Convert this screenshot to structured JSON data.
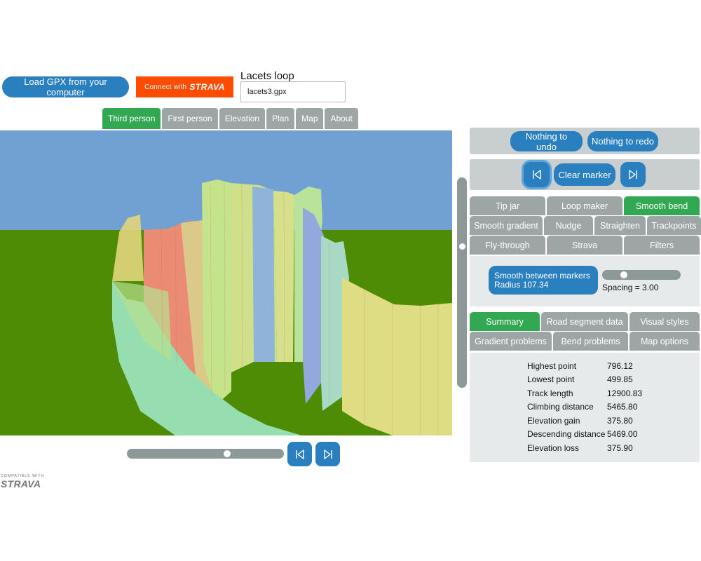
{
  "header": {
    "load_label": "Load GPX from your computer",
    "strava_connect_prefix": "Connect with",
    "strava_connect_brand": "STRAVA",
    "route_title": "Lacets loop",
    "file_name": "lacets3.gpx"
  },
  "view_tabs": [
    {
      "label": "Third person",
      "active": true
    },
    {
      "label": "First person",
      "active": false
    },
    {
      "label": "Elevation",
      "active": false
    },
    {
      "label": "Plan",
      "active": false
    },
    {
      "label": "Map",
      "active": false
    },
    {
      "label": "About",
      "active": false
    }
  ],
  "scene": {
    "sky_color": "#71a0d2",
    "ground_color": "#4e8c06",
    "description_icon": "3d-route-render"
  },
  "playback": {
    "position": 0.65,
    "prev_icon": "skip-previous-icon",
    "next_icon": "skip-next-icon"
  },
  "badge": {
    "small": "COMPATIBLE WITH",
    "big": "STRAVA"
  },
  "panel": {
    "undo_label": "Nothing to undo",
    "redo_label": "Nothing to redo",
    "clear_marker_label": "Clear marker",
    "tools_row1": [
      {
        "label": "Tip jar",
        "active": false
      },
      {
        "label": "Loop maker",
        "active": false
      },
      {
        "label": "Smooth bend",
        "active": true
      }
    ],
    "tools_row2": [
      {
        "label": "Smooth gradient",
        "active": false
      },
      {
        "label": "Nudge",
        "active": false
      },
      {
        "label": "Straighten",
        "active": false
      },
      {
        "label": "Trackpoints",
        "active": false
      }
    ],
    "tools_row3": [
      {
        "label": "Fly-through",
        "active": false
      },
      {
        "label": "Strava",
        "active": false
      },
      {
        "label": "Filters",
        "active": false
      }
    ],
    "smooth_line1": "Smooth between markers",
    "smooth_line2": "Radius 107.34",
    "spacing_label": "Spacing = 3.00",
    "spacing_position": 0.24,
    "info_row1": [
      {
        "label": "Summary",
        "active": true
      },
      {
        "label": "Road segment data",
        "active": false
      },
      {
        "label": "Visual styles",
        "active": false
      }
    ],
    "info_row2": [
      {
        "label": "Gradient problems",
        "active": false
      },
      {
        "label": "Bend problems",
        "active": false
      },
      {
        "label": "Map options",
        "active": false
      }
    ],
    "summary": [
      {
        "label": "Highest point",
        "value": "796.12"
      },
      {
        "label": "Lowest point",
        "value": "499.85"
      },
      {
        "label": "Track length",
        "value": "12900.83"
      },
      {
        "label": "Climbing distance",
        "value": "5465.80"
      },
      {
        "label": "Elevation gain",
        "value": "375.80"
      },
      {
        "label": "Descending distance",
        "value": "5469.00"
      },
      {
        "label": "Elevation loss",
        "value": "375.90"
      }
    ]
  }
}
